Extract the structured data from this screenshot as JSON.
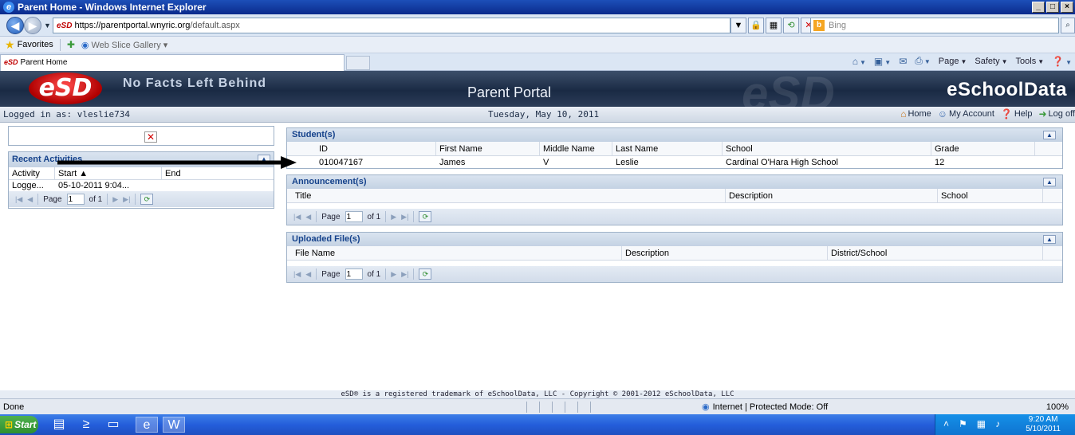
{
  "window": {
    "title": "Parent Home - Windows Internet Explorer",
    "ie_logo": "e",
    "buttons": [
      "_",
      "□",
      "×"
    ]
  },
  "address": {
    "site_icon": "eSD",
    "url_scheme": "https://",
    "url_host": "parentportal.wnyric.org",
    "url_path": "/default.aspx",
    "search_placeholder": "Bing",
    "bing_logo": "b"
  },
  "favorites": {
    "label": "Favorites",
    "web_slice": "Web Slice Gallery ▾"
  },
  "tab": {
    "icon": "eSD",
    "label": "Parent Home"
  },
  "command_bar": {
    "page": "Page",
    "safety": "Safety",
    "tools": "Tools"
  },
  "site": {
    "logo": "eSD",
    "tagline": "No Facts Left Behind",
    "portal_title": "Parent Portal",
    "brand": "eSchoolData",
    "ghost": "eSD"
  },
  "userbar": {
    "logged_in": "Logged in as: vleslie734",
    "date": "Tuesday, May 10, 2011",
    "links": {
      "home": "Home",
      "account": "My Account",
      "help": "Help",
      "logoff": "Log off"
    }
  },
  "recent": {
    "title": "Recent Activities",
    "columns": [
      "Activity",
      "Start ▲",
      "End"
    ],
    "rows": [
      {
        "activity": "Logge...",
        "start": "05-10-2011 9:04...",
        "end": ""
      }
    ],
    "pager": {
      "page_label": "Page",
      "page": "1",
      "of": "of 1"
    }
  },
  "students": {
    "title": "Student(s)",
    "columns": [
      "ID",
      "First Name",
      "Middle Name",
      "Last Name",
      "School",
      "Grade"
    ],
    "rows": [
      {
        "id": "010047167",
        "first": "James",
        "middle": "V",
        "last": "Leslie",
        "school": "Cardinal O'Hara High School",
        "grade": "12"
      }
    ]
  },
  "announcements": {
    "title": "Announcement(s)",
    "columns": [
      "Title",
      "Description",
      "School"
    ],
    "pager": {
      "page_label": "Page",
      "page": "1",
      "of": "of 1"
    }
  },
  "uploads": {
    "title": "Uploaded File(s)",
    "columns": [
      "File Name",
      "Description",
      "District/School"
    ],
    "pager": {
      "page_label": "Page",
      "page": "1",
      "of": "of 1"
    }
  },
  "footer": "eSD® is a registered trademark of eSchoolData, LLC - Copyright © 2001-2012 eSchoolData, LLC",
  "status": {
    "done": "Done",
    "zone": "Internet | Protected Mode: Off",
    "zoom": "100%"
  },
  "taskbar": {
    "start": "Start",
    "time": "9:20 AM",
    "date": "5/10/2011"
  },
  "colors": {
    "header_dark": "#1a2a44",
    "panel_title": "#15428b",
    "logo_red": "#b00000"
  }
}
